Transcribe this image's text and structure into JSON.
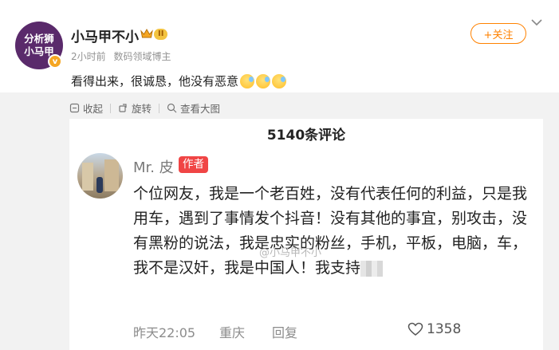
{
  "post": {
    "avatar_line1": "分析狮",
    "avatar_line2": "小马甲",
    "verified_mark": "v",
    "username": "小马甲不小",
    "level_badge": "II",
    "time": "2小时前",
    "author_type": "数码领域博主",
    "follow_label": "+关注",
    "text": "看得出来，很诚恳，他没有恶意"
  },
  "toolbar": {
    "collapse_label": "收起",
    "rotate_label": "旋转",
    "view_large_label": "查看大图"
  },
  "comment_screenshot": {
    "count_title": "5140条评论",
    "commenter_name": "Mr. 皮",
    "author_tag": "作者",
    "body": "个位网友，我是一个老百姓，没有代表任何的利益，只是我用车，遇到了事情发个抖音！没有其他的事宜，别攻击，没有黑粉的说法，我是忠实的粉丝，手机，平板，电脑，车，我不是汉奸，我是中国人！我支持",
    "watermark": "@小马甲不小",
    "time": "昨天22:05",
    "location": "重庆",
    "reply_label": "回复",
    "like_count": "1358"
  },
  "icons": {
    "crown": "crown-icon",
    "chevron": "chevron-down-icon",
    "collapse": "collapse-icon",
    "rotate": "rotate-icon",
    "zoom": "zoom-icon",
    "heart": "heart-icon",
    "emoji": "sweat-emoji"
  },
  "colors": {
    "accent_orange": "#ff8200",
    "author_tag_red": "#f04545",
    "badge_gold": "#f3c33f",
    "background_gray": "#f2f2f2"
  }
}
